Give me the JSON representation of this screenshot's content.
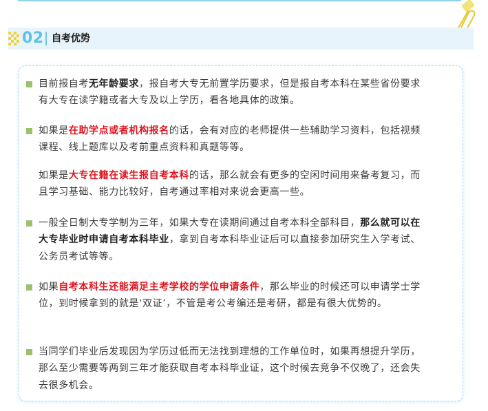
{
  "section": {
    "number": "02",
    "title": "自考优势"
  },
  "colors": {
    "accent_blue": "#5fc0e8",
    "header_band": "#e8f4fb",
    "bullet_green": "#9bc26a",
    "highlight_red": "#e0141e"
  },
  "icons": [
    "checker-icon",
    "paperclip-icon",
    "bullet-square-icon"
  ],
  "paragraphs": [
    {
      "bullet": true,
      "parts": [
        {
          "text": "目前报自考",
          "style": "normal"
        },
        {
          "text": "无年龄要求",
          "style": "bold"
        },
        {
          "text": "，报自考大专无前置学历要求，但是报自考本科在某些省份要求有大专在读学籍或者大专及以上学历，看各地具体的政策。",
          "style": "normal"
        }
      ]
    },
    {
      "bullet": true,
      "parts": [
        {
          "text": "如果是",
          "style": "normal"
        },
        {
          "text": "在助学点或者机构报名",
          "style": "red"
        },
        {
          "text": "的话，会有对应的老师提供一些辅助学习资料，包括视频课程、线上题库以及考前重点资料和真题等等。",
          "style": "normal"
        }
      ]
    },
    {
      "bullet": false,
      "parts": [
        {
          "text": "如果是",
          "style": "normal"
        },
        {
          "text": "大专在籍在读生报自考本科",
          "style": "red"
        },
        {
          "text": "的话，那么就会有更多的空闲时间用来备考复习，而且学习基础、能力比较好，自考通过率相对来说会更高一些。",
          "style": "normal"
        }
      ]
    },
    {
      "bullet": true,
      "parts": [
        {
          "text": "一般全日制大专学制为三年，如果大专在读期间通过自考本科全部科目，",
          "style": "normal"
        },
        {
          "text": "那么就可以在大专毕业时申请自考本科毕业",
          "style": "bold"
        },
        {
          "text": "，拿到自考本科毕业证后可以直接参加研究生入学考试、公务员考试等等。",
          "style": "normal"
        }
      ]
    },
    {
      "bullet": true,
      "parts": [
        {
          "text": "如果",
          "style": "normal"
        },
        {
          "text": "自考本科生还能满足主考学校的学位申请条件",
          "style": "red"
        },
        {
          "text": "，那么毕业的时候还可以申请学士学位，到时候拿到的就是‘双证’，不管是考公考编还是考研，都是有很大优势的。",
          "style": "normal"
        }
      ]
    },
    {
      "bullet": true,
      "parts": [
        {
          "text": "当同学们毕业后发现因为学历过低而无法找到理想的工作单位时，如果再想提升学历，那么至少需要等两到三年才能获取自考本科毕业证，这个时候去竞争不仅晚了，还会失去很多机会。",
          "style": "normal"
        }
      ]
    }
  ]
}
